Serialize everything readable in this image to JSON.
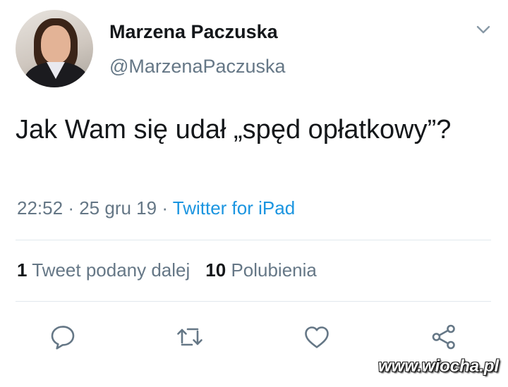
{
  "tweet": {
    "author": {
      "display_name": "Marzena Paczuska",
      "handle": "@MarzenaPaczuska"
    },
    "text": "Jak Wam się udał „spęd opłatkowy”?",
    "time": "22:52",
    "separator": "·",
    "date": "25 gru 19",
    "source": "Twitter for iPad",
    "retweets": {
      "count": "1",
      "label": "Tweet podany dalej"
    },
    "likes": {
      "count": "10",
      "label": "Polubienia"
    }
  },
  "actions": [
    {
      "icon": "reply-icon"
    },
    {
      "icon": "retweet-icon"
    },
    {
      "icon": "like-icon"
    },
    {
      "icon": "share-icon"
    }
  ],
  "watermark": "www.wiocha.pl",
  "colors": {
    "text": "#14171a",
    "secondary": "#657786",
    "link": "#1b95e0",
    "divider": "#e1e8ed"
  }
}
